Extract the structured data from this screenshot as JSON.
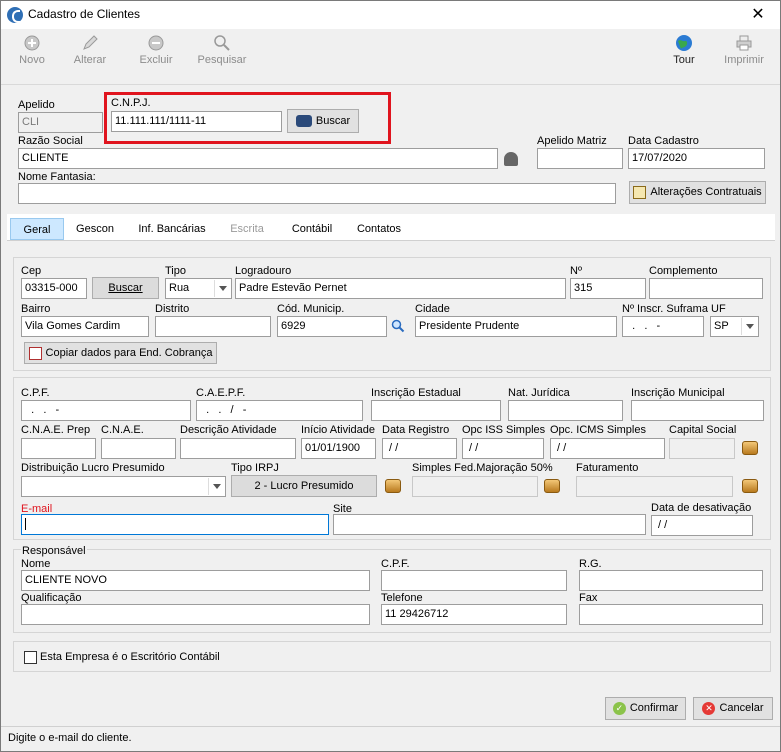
{
  "window": {
    "title": "Cadastro de Clientes",
    "close_label": "✕"
  },
  "toolbar": {
    "novo": "Novo",
    "alterar": "Alterar",
    "excluir": "Excluir",
    "pesquisar": "Pesquisar",
    "tour": "Tour",
    "imprimir": "Imprimir"
  },
  "header": {
    "apelido_label": "Apelido",
    "apelido_value": "CLI",
    "cnpj_label": "C.N.P.J.",
    "cnpj_value": "11.111.111/1111-11",
    "buscar_label": "Buscar",
    "razao_label": "Razão Social",
    "razao_value": "CLIENTE",
    "apelido_matriz_label": "Apelido Matriz",
    "apelido_matriz_value": "",
    "data_cadastro_label": "Data Cadastro",
    "data_cadastro_value": "17/07/2020",
    "fantasia_label": "Nome Fantasia:",
    "fantasia_value": "",
    "alteracoes_label": "Alterações Contratuais"
  },
  "tabs": [
    "Geral",
    "Gescon",
    "Inf. Bancárias",
    "Escrita",
    "Contábil",
    "Contatos"
  ],
  "address": {
    "cep_label": "Cep",
    "cep_value": "03315-000",
    "buscar_label": "Buscar",
    "tipo_label": "Tipo",
    "tipo_value": "Rua",
    "logradouro_label": "Logradouro",
    "logradouro_value": "Padre Estevão Pernet",
    "numero_label": "Nº",
    "numero_value": "315",
    "complemento_label": "Complemento",
    "complemento_value": "",
    "bairro_label": "Bairro",
    "bairro_value": "Vila Gomes Cardim",
    "distrito_label": "Distrito",
    "distrito_value": "",
    "municipio_label": "Cód. Municip.",
    "municipio_value": "6929",
    "cidade_label": "Cidade",
    "cidade_value": "Presidente Prudente",
    "suframa_label": "Nº Inscr. Suframa",
    "suframa_value": "  .   .   -",
    "uf_label": "UF",
    "uf_value": "SP",
    "copiar_label": "Copiar dados para End. Cobrança"
  },
  "fiscal": {
    "cpf_label": "C.P.F.",
    "cpf_value": "  .   .   -",
    "caepf_label": "C.A.E.P.F.",
    "caepf_value": "  .   .   /   -",
    "ie_label": "Inscrição Estadual",
    "ie_value": "",
    "natureza_label": "Nat. Jurídica",
    "natureza_value": "",
    "im_label": "Inscrição Municipal",
    "im_value": "",
    "cnae_prep_label": "C.N.A.E. Prep",
    "cnae_label": "C.N.A.E.",
    "descricao_label": "Descrição Atividade",
    "inicio_label": "Início Atividade",
    "inicio_value": "01/01/1900",
    "registro_label": "Data Registro",
    "registro_value": " / /",
    "iss_label": "Opc ISS Simples",
    "iss_value": " / /",
    "icms_label": "Opc. ICMS Simples",
    "icms_value": " / /",
    "capital_label": "Capital Social",
    "distribuicao_label": "Distribuição Lucro Presumido",
    "irpj_label": "Tipo IRPJ",
    "irpj_value": "2 - Lucro Presumido",
    "simples_label": "Simples Fed.Majoração 50%",
    "faturamento_label": "Faturamento",
    "email_label": "E-mail",
    "email_value": "",
    "site_label": "Site",
    "site_value": "",
    "desativacao_label": "Data de desativação",
    "desativacao_value": " / /"
  },
  "responsavel": {
    "section_label": "Responsável",
    "nome_label": "Nome",
    "nome_value": "CLIENTE NOVO",
    "cpf_label": "C.P.F.",
    "cpf_value": "",
    "rg_label": "R.G.",
    "rg_value": "",
    "qualificacao_label": "Qualificação",
    "qualificacao_value": "",
    "telefone_label": "Telefone",
    "telefone_value": "11 29426712",
    "fax_label": "Fax",
    "fax_value": ""
  },
  "escritorio_label": "Esta Empresa é o Escritório Contábil",
  "footer": {
    "confirmar": "Confirmar",
    "cancelar": "Cancelar"
  },
  "status": "Digite o e-mail do cliente."
}
